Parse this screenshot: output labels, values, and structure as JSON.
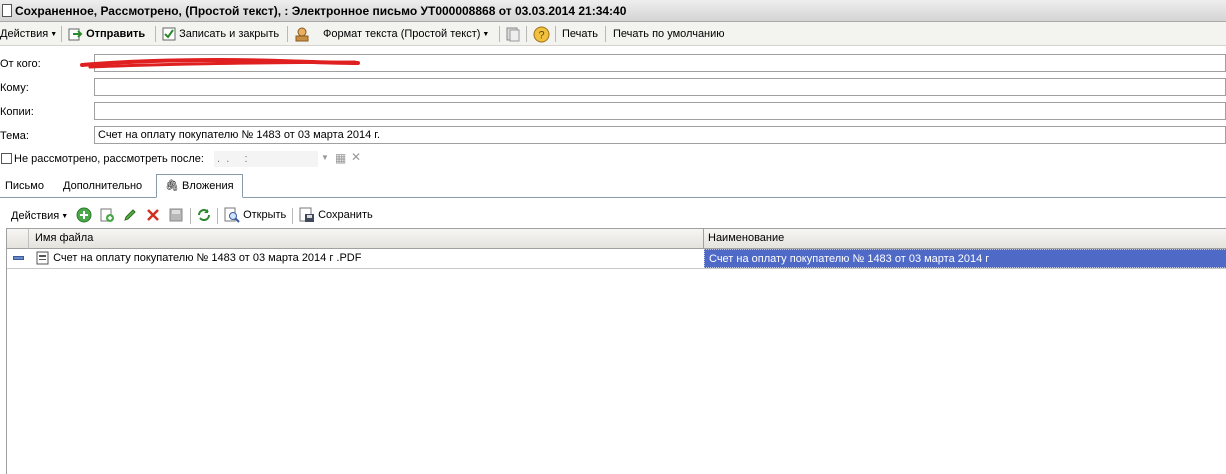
{
  "window": {
    "title": "Сохраненное, Рассмотрено,  (Простой текст), : Электронное письмо УТ000008868 от 03.03.2014 21:34:40"
  },
  "toolbar": {
    "actions_label": "Действия",
    "send_label": "Отправить",
    "save_close_label": "Записать и закрыть",
    "format_label": "Формат текста (Простой текст)",
    "print_label": "Печать",
    "print_default_label": "Печать по умолчанию"
  },
  "form": {
    "from_label": "От кого:",
    "to_label": "Кому:",
    "cc_label": "Копии:",
    "subject_label": "Тема:",
    "subject_value": "Счет на оплату покупателю № 1483 от 03 марта 2014 г.",
    "review_label": "Не рассмотрено, рассмотреть после:",
    "review_date_value": " .  .     :  ",
    "review_checked": false
  },
  "tabs": [
    {
      "label": "Письмо"
    },
    {
      "label": "Дополнительно"
    },
    {
      "label": "Вложения",
      "active": true
    }
  ],
  "attachments_toolbar": {
    "actions_label": "Действия",
    "open_label": "Открыть",
    "save_label": "Сохранить"
  },
  "grid": {
    "columns": [
      "Имя файла",
      "Наименование"
    ],
    "rows": [
      {
        "file_name": "Счет на оплату покупателю № 1483 от 03 марта 2014 г .PDF",
        "name": "Счет на оплату покупателю № 1483 от 03 марта 2014 г"
      }
    ]
  },
  "colors": {
    "selection": "#4f69c6",
    "redaction": "#e02020"
  }
}
